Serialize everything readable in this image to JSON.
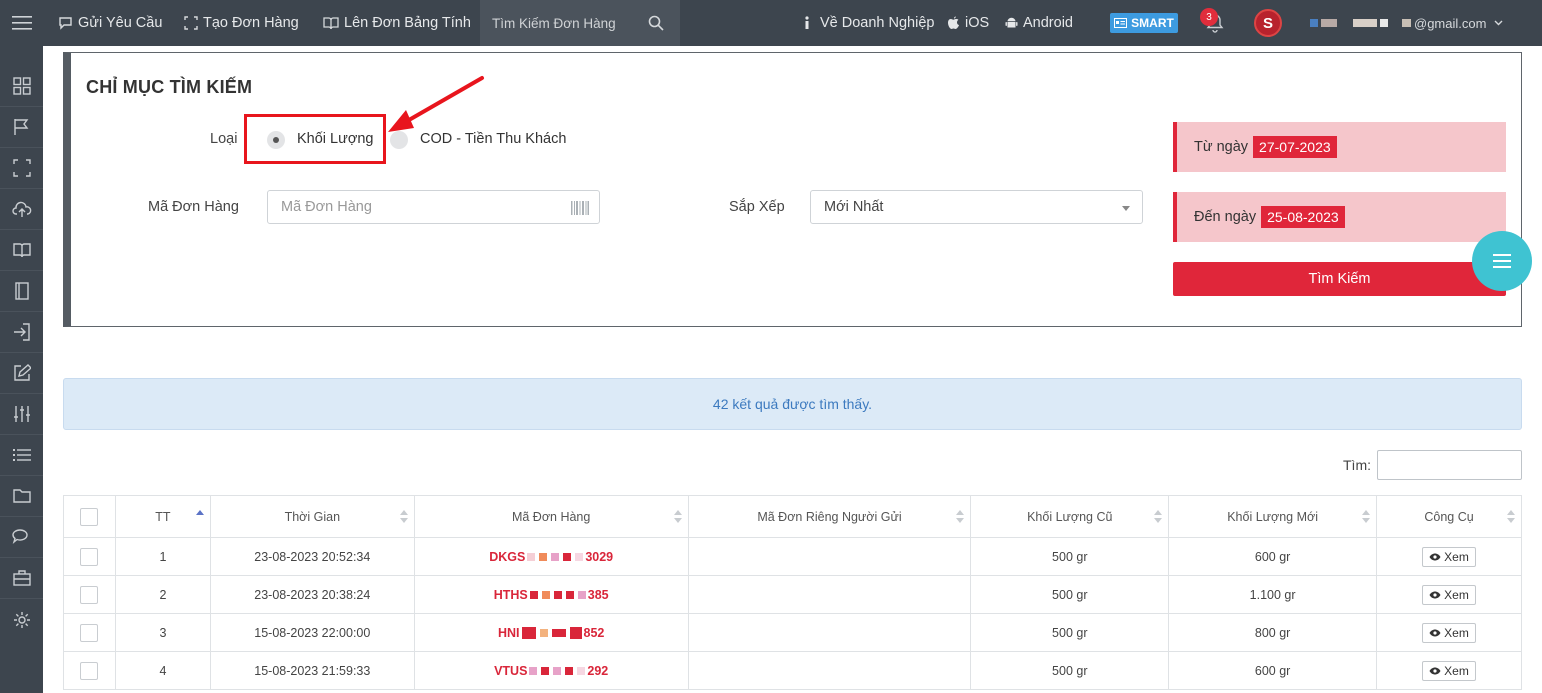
{
  "topbar": {
    "nav": [
      {
        "label": "Gửi Yêu Cầu",
        "icon": "chat-icon"
      },
      {
        "label": "Tạo Đơn Hàng",
        "icon": "expand-icon"
      },
      {
        "label": "Lên Đơn Bảng Tính",
        "icon": "book-icon"
      }
    ],
    "search_placeholder": "Tìm Kiếm Đơn Hàng",
    "about": "Về Doanh Nghiệp",
    "ios": "iOS",
    "android": "Android",
    "smart": "SMART",
    "notification_count": "3",
    "avatar_letter": "S",
    "email_suffix": "@gmail.com"
  },
  "sidebar": {
    "icons": [
      "grid-icon",
      "flag-icon",
      "fullscreen-icon",
      "cloud-upload-icon",
      "book-icon",
      "notebook-icon",
      "login-icon",
      "edit-icon",
      "sliders-icon",
      "list-icon",
      "folder-icon",
      "comments-icon",
      "briefcase-icon",
      "gear-icon"
    ]
  },
  "search_panel": {
    "title": "CHỈ MỤC TÌM KIẾM",
    "type_label": "Loại",
    "option_weight": "Khối Lượng",
    "option_cod": "COD - Tiền Thu Khách",
    "order_code_label": "Mã Đơn Hàng",
    "order_code_placeholder": "Mã Đơn Hàng",
    "sort_label": "Sắp Xếp",
    "sort_value": "Mới Nhất",
    "from_label": "Từ ngày",
    "from_date": "27-07-2023",
    "to_label": "Đến ngày",
    "to_date": "25-08-2023",
    "search_button": "Tìm Kiếm"
  },
  "results": {
    "summary": "42 kết quả được tìm thấy.",
    "filter_label": "Tìm:"
  },
  "table": {
    "headers": [
      "TT",
      "Thời Gian",
      "Mã Đơn Hàng",
      "Mã Đơn Riêng Người Gửi",
      "Khối Lượng Cũ",
      "Khối Lượng Mới",
      "Công Cụ"
    ],
    "view_label": "Xem",
    "rows": [
      {
        "tt": "1",
        "time": "23-08-2023 20:52:34",
        "code_prefix": "DKGS",
        "code_suffix": "3029",
        "sender_code": "",
        "old_weight": "500 gr",
        "new_weight": "600 gr"
      },
      {
        "tt": "2",
        "time": "23-08-2023 20:38:24",
        "code_prefix": "HTHS",
        "code_suffix": "385",
        "sender_code": "",
        "old_weight": "500 gr",
        "new_weight": "1.100 gr"
      },
      {
        "tt": "3",
        "time": "15-08-2023 22:00:00",
        "code_prefix": "HNI",
        "code_suffix": "852",
        "sender_code": "",
        "old_weight": "500 gr",
        "new_weight": "800 gr"
      },
      {
        "tt": "4",
        "time": "15-08-2023 21:59:33",
        "code_prefix": "VTUS",
        "code_suffix": "292",
        "sender_code": "",
        "old_weight": "500 gr",
        "new_weight": "600 gr"
      }
    ]
  },
  "colors": {
    "topbar": "#3d454e",
    "accent_red": "#e0263a",
    "date_bg": "#f5c6cb",
    "fab": "#3fc3d2",
    "results_bg": "#dceaf7"
  }
}
